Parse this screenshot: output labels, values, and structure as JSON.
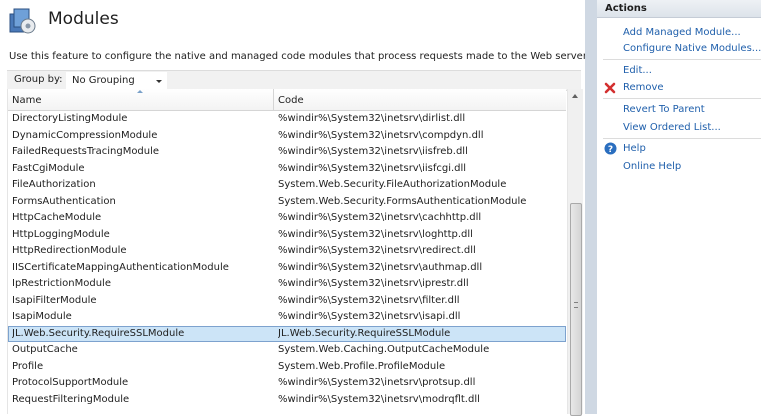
{
  "page": {
    "title": "Modules",
    "description": "Use this feature to configure the native and managed code modules that process requests made to the Web server."
  },
  "toolbar": {
    "group_by_label": "Group by:",
    "group_by_value": "No Grouping"
  },
  "grid": {
    "columns": [
      "Name",
      "Code"
    ],
    "rows": [
      {
        "name": "DirectoryListingModule",
        "code": "%windir%\\System32\\inetsrv\\dirlist.dll"
      },
      {
        "name": "DynamicCompressionModule",
        "code": "%windir%\\System32\\inetsrv\\compdyn.dll"
      },
      {
        "name": "FailedRequestsTracingModule",
        "code": "%windir%\\System32\\inetsrv\\iisfreb.dll"
      },
      {
        "name": "FastCgiModule",
        "code": "%windir%\\System32\\inetsrv\\iisfcgi.dll"
      },
      {
        "name": "FileAuthorization",
        "code": "System.Web.Security.FileAuthorizationModule"
      },
      {
        "name": "FormsAuthentication",
        "code": "System.Web.Security.FormsAuthenticationModule"
      },
      {
        "name": "HttpCacheModule",
        "code": "%windir%\\System32\\inetsrv\\cachhttp.dll"
      },
      {
        "name": "HttpLoggingModule",
        "code": "%windir%\\System32\\inetsrv\\loghttp.dll"
      },
      {
        "name": "HttpRedirectionModule",
        "code": "%windir%\\System32\\inetsrv\\redirect.dll"
      },
      {
        "name": "IISCertificateMappingAuthenticationModule",
        "code": "%windir%\\System32\\inetsrv\\authmap.dll"
      },
      {
        "name": "IpRestrictionModule",
        "code": "%windir%\\System32\\inetsrv\\iprestr.dll"
      },
      {
        "name": "IsapiFilterModule",
        "code": "%windir%\\System32\\inetsrv\\filter.dll"
      },
      {
        "name": "IsapiModule",
        "code": "%windir%\\System32\\inetsrv\\isapi.dll"
      },
      {
        "name": "JL.Web.Security.RequireSSLModule",
        "code": "JL.Web.Security.RequireSSLModule",
        "selected": true
      },
      {
        "name": "OutputCache",
        "code": "System.Web.Caching.OutputCacheModule"
      },
      {
        "name": "Profile",
        "code": "System.Web.Profile.ProfileModule"
      },
      {
        "name": "ProtocolSupportModule",
        "code": "%windir%\\System32\\inetsrv\\protsup.dll"
      },
      {
        "name": "RequestFilteringModule",
        "code": "%windir%\\System32\\inetsrv\\modrqflt.dll"
      }
    ]
  },
  "actions": {
    "title": "Actions",
    "add_managed": "Add Managed Module...",
    "configure_native": "Configure Native Modules...",
    "edit": "Edit...",
    "remove": "Remove",
    "revert": "Revert To Parent",
    "view_ordered": "View Ordered List...",
    "help": "Help",
    "online_help": "Online Help"
  },
  "colors": {
    "link": "#1f5fab",
    "selection": "#cce4f7",
    "remove_icon": "#d32f2f",
    "help_icon": "#2a6ebf"
  }
}
